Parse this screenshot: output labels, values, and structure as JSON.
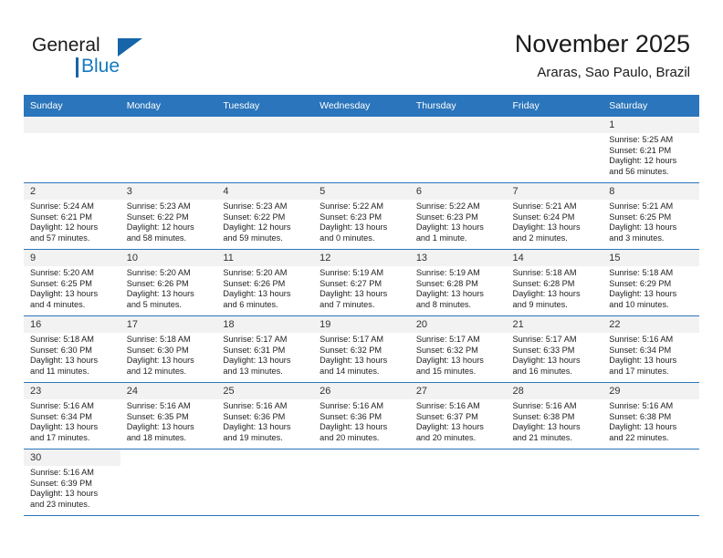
{
  "brand": {
    "name_primary": "General",
    "name_secondary": "Blue"
  },
  "header": {
    "title": "November 2025",
    "subtitle": "Araras, Sao Paulo, Brazil"
  },
  "colors": {
    "header_blue": "#2a75bb",
    "brand_blue": "#1479bf",
    "daynum_band": "#f2f2f2",
    "row_border": "#2a75bb"
  },
  "weekdays": [
    "Sunday",
    "Monday",
    "Tuesday",
    "Wednesday",
    "Thursday",
    "Friday",
    "Saturday"
  ],
  "weeks": [
    [
      {
        "day": "",
        "lines": []
      },
      {
        "day": "",
        "lines": []
      },
      {
        "day": "",
        "lines": []
      },
      {
        "day": "",
        "lines": []
      },
      {
        "day": "",
        "lines": []
      },
      {
        "day": "",
        "lines": []
      },
      {
        "day": "1",
        "lines": [
          "Sunrise: 5:25 AM",
          "Sunset: 6:21 PM",
          "Daylight: 12 hours",
          "and 56 minutes."
        ]
      }
    ],
    [
      {
        "day": "2",
        "lines": [
          "Sunrise: 5:24 AM",
          "Sunset: 6:21 PM",
          "Daylight: 12 hours",
          "and 57 minutes."
        ]
      },
      {
        "day": "3",
        "lines": [
          "Sunrise: 5:23 AM",
          "Sunset: 6:22 PM",
          "Daylight: 12 hours",
          "and 58 minutes."
        ]
      },
      {
        "day": "4",
        "lines": [
          "Sunrise: 5:23 AM",
          "Sunset: 6:22 PM",
          "Daylight: 12 hours",
          "and 59 minutes."
        ]
      },
      {
        "day": "5",
        "lines": [
          "Sunrise: 5:22 AM",
          "Sunset: 6:23 PM",
          "Daylight: 13 hours",
          "and 0 minutes."
        ]
      },
      {
        "day": "6",
        "lines": [
          "Sunrise: 5:22 AM",
          "Sunset: 6:23 PM",
          "Daylight: 13 hours",
          "and 1 minute."
        ]
      },
      {
        "day": "7",
        "lines": [
          "Sunrise: 5:21 AM",
          "Sunset: 6:24 PM",
          "Daylight: 13 hours",
          "and 2 minutes."
        ]
      },
      {
        "day": "8",
        "lines": [
          "Sunrise: 5:21 AM",
          "Sunset: 6:25 PM",
          "Daylight: 13 hours",
          "and 3 minutes."
        ]
      }
    ],
    [
      {
        "day": "9",
        "lines": [
          "Sunrise: 5:20 AM",
          "Sunset: 6:25 PM",
          "Daylight: 13 hours",
          "and 4 minutes."
        ]
      },
      {
        "day": "10",
        "lines": [
          "Sunrise: 5:20 AM",
          "Sunset: 6:26 PM",
          "Daylight: 13 hours",
          "and 5 minutes."
        ]
      },
      {
        "day": "11",
        "lines": [
          "Sunrise: 5:20 AM",
          "Sunset: 6:26 PM",
          "Daylight: 13 hours",
          "and 6 minutes."
        ]
      },
      {
        "day": "12",
        "lines": [
          "Sunrise: 5:19 AM",
          "Sunset: 6:27 PM",
          "Daylight: 13 hours",
          "and 7 minutes."
        ]
      },
      {
        "day": "13",
        "lines": [
          "Sunrise: 5:19 AM",
          "Sunset: 6:28 PM",
          "Daylight: 13 hours",
          "and 8 minutes."
        ]
      },
      {
        "day": "14",
        "lines": [
          "Sunrise: 5:18 AM",
          "Sunset: 6:28 PM",
          "Daylight: 13 hours",
          "and 9 minutes."
        ]
      },
      {
        "day": "15",
        "lines": [
          "Sunrise: 5:18 AM",
          "Sunset: 6:29 PM",
          "Daylight: 13 hours",
          "and 10 minutes."
        ]
      }
    ],
    [
      {
        "day": "16",
        "lines": [
          "Sunrise: 5:18 AM",
          "Sunset: 6:30 PM",
          "Daylight: 13 hours",
          "and 11 minutes."
        ]
      },
      {
        "day": "17",
        "lines": [
          "Sunrise: 5:18 AM",
          "Sunset: 6:30 PM",
          "Daylight: 13 hours",
          "and 12 minutes."
        ]
      },
      {
        "day": "18",
        "lines": [
          "Sunrise: 5:17 AM",
          "Sunset: 6:31 PM",
          "Daylight: 13 hours",
          "and 13 minutes."
        ]
      },
      {
        "day": "19",
        "lines": [
          "Sunrise: 5:17 AM",
          "Sunset: 6:32 PM",
          "Daylight: 13 hours",
          "and 14 minutes."
        ]
      },
      {
        "day": "20",
        "lines": [
          "Sunrise: 5:17 AM",
          "Sunset: 6:32 PM",
          "Daylight: 13 hours",
          "and 15 minutes."
        ]
      },
      {
        "day": "21",
        "lines": [
          "Sunrise: 5:17 AM",
          "Sunset: 6:33 PM",
          "Daylight: 13 hours",
          "and 16 minutes."
        ]
      },
      {
        "day": "22",
        "lines": [
          "Sunrise: 5:16 AM",
          "Sunset: 6:34 PM",
          "Daylight: 13 hours",
          "and 17 minutes."
        ]
      }
    ],
    [
      {
        "day": "23",
        "lines": [
          "Sunrise: 5:16 AM",
          "Sunset: 6:34 PM",
          "Daylight: 13 hours",
          "and 17 minutes."
        ]
      },
      {
        "day": "24",
        "lines": [
          "Sunrise: 5:16 AM",
          "Sunset: 6:35 PM",
          "Daylight: 13 hours",
          "and 18 minutes."
        ]
      },
      {
        "day": "25",
        "lines": [
          "Sunrise: 5:16 AM",
          "Sunset: 6:36 PM",
          "Daylight: 13 hours",
          "and 19 minutes."
        ]
      },
      {
        "day": "26",
        "lines": [
          "Sunrise: 5:16 AM",
          "Sunset: 6:36 PM",
          "Daylight: 13 hours",
          "and 20 minutes."
        ]
      },
      {
        "day": "27",
        "lines": [
          "Sunrise: 5:16 AM",
          "Sunset: 6:37 PM",
          "Daylight: 13 hours",
          "and 20 minutes."
        ]
      },
      {
        "day": "28",
        "lines": [
          "Sunrise: 5:16 AM",
          "Sunset: 6:38 PM",
          "Daylight: 13 hours",
          "and 21 minutes."
        ]
      },
      {
        "day": "29",
        "lines": [
          "Sunrise: 5:16 AM",
          "Sunset: 6:38 PM",
          "Daylight: 13 hours",
          "and 22 minutes."
        ]
      }
    ],
    [
      {
        "day": "30",
        "lines": [
          "Sunrise: 5:16 AM",
          "Sunset: 6:39 PM",
          "Daylight: 13 hours",
          "and 23 minutes."
        ]
      },
      {
        "day": "",
        "lines": []
      },
      {
        "day": "",
        "lines": []
      },
      {
        "day": "",
        "lines": []
      },
      {
        "day": "",
        "lines": []
      },
      {
        "day": "",
        "lines": []
      },
      {
        "day": "",
        "lines": []
      }
    ]
  ]
}
